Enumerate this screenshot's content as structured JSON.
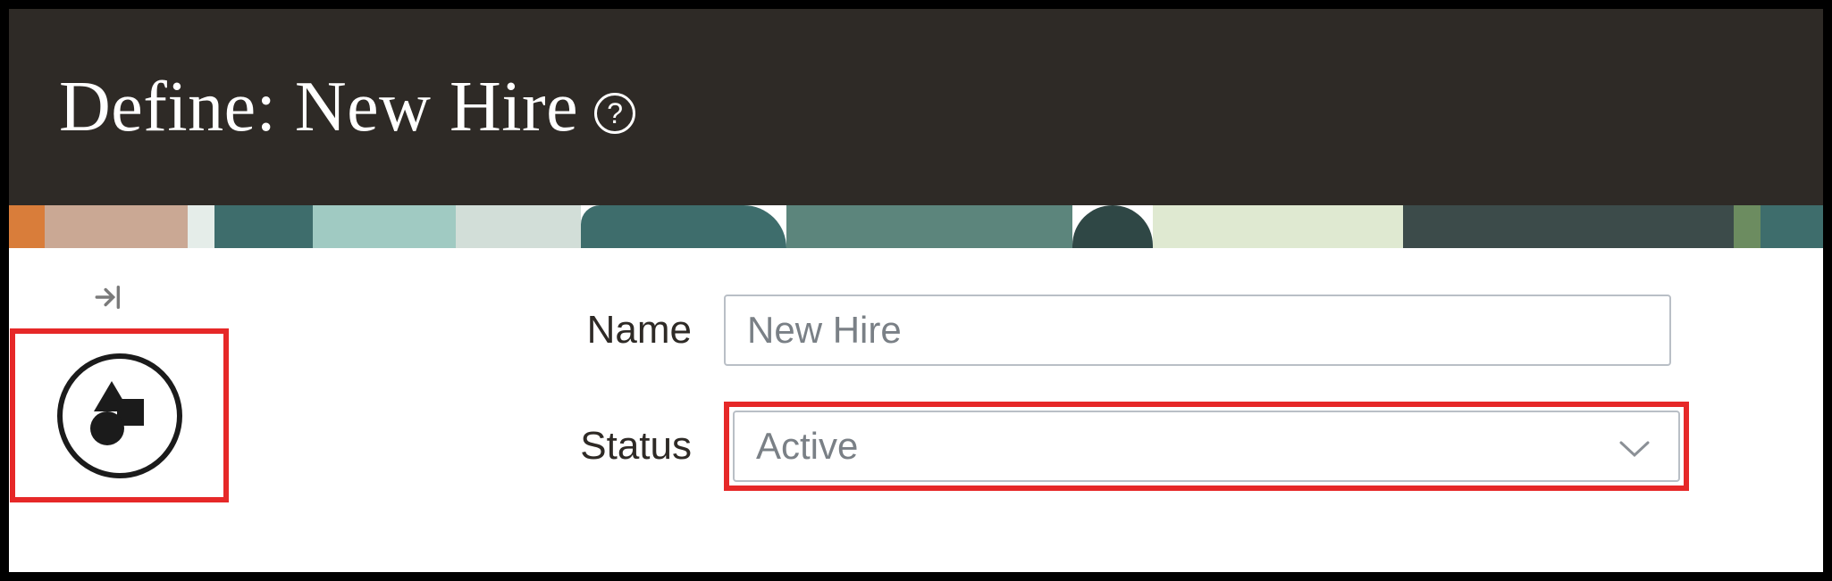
{
  "header": {
    "title": "Define: New Hire",
    "help_glyph": "?"
  },
  "form": {
    "name_label": "Name",
    "name_value": "New Hire",
    "status_label": "Status",
    "status_value": "Active"
  },
  "icons": {
    "collapse": "collapse-sidebar-icon",
    "shapes": "shapes-icon",
    "chevron_down": "chevron-down-icon",
    "help": "help-icon"
  }
}
